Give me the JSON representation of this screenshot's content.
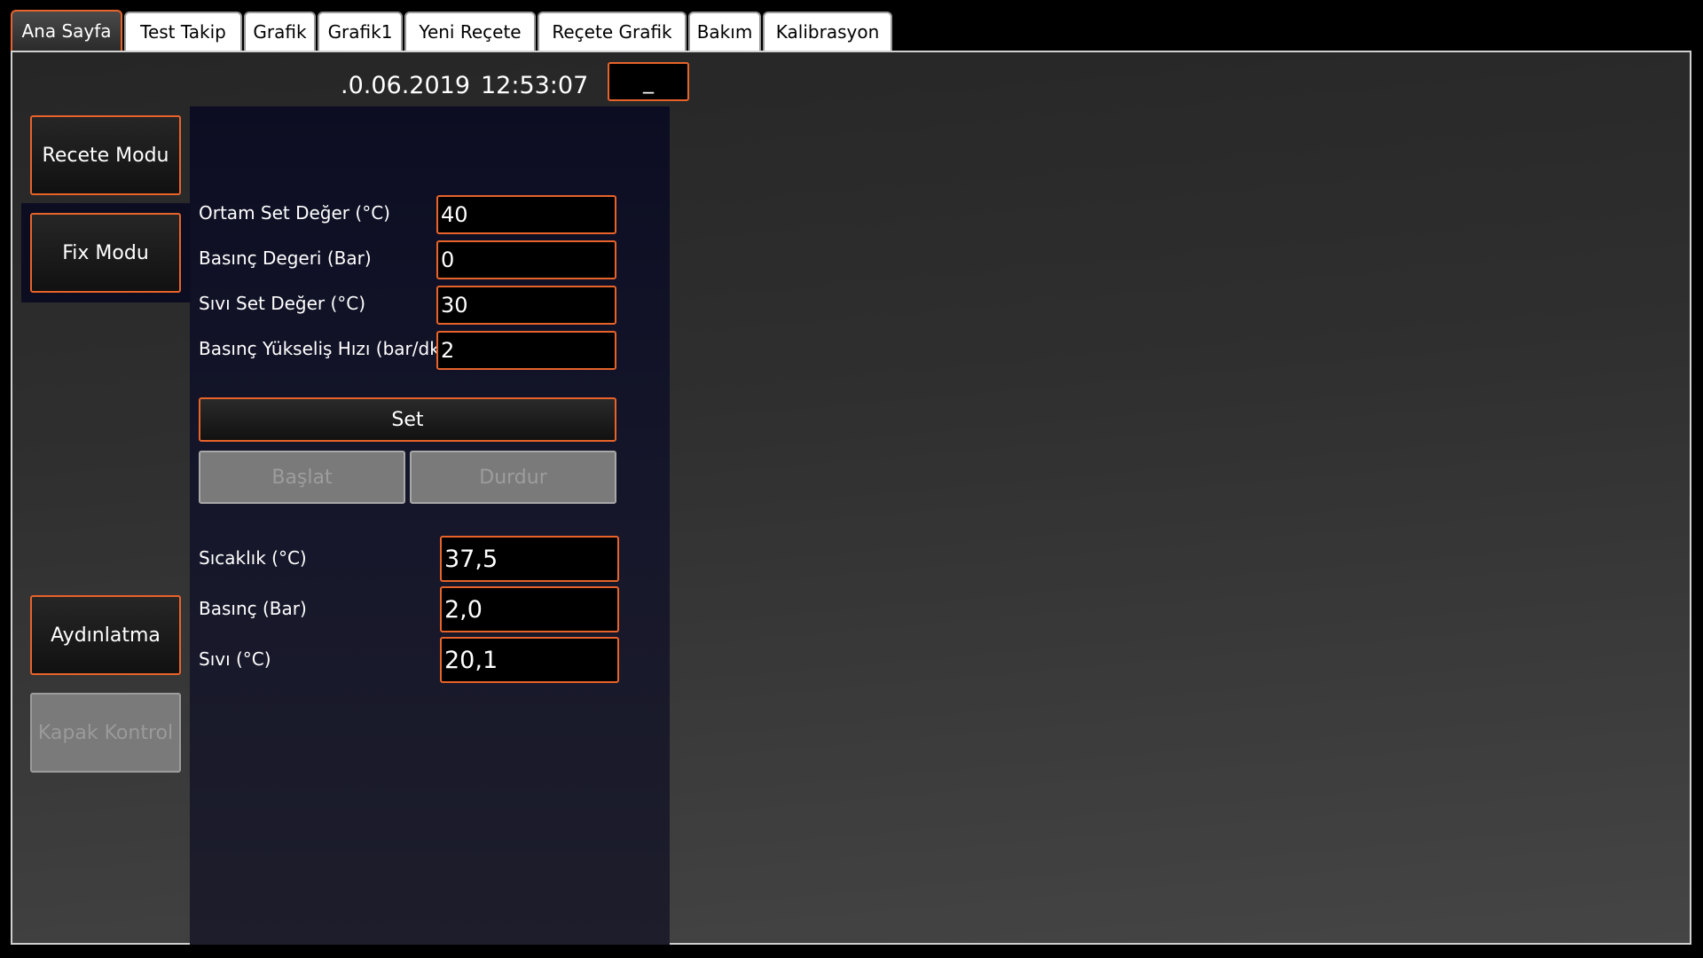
{
  "tabs": [
    {
      "label": "Ana Sayfa",
      "active": true
    },
    {
      "label": "Test Takip"
    },
    {
      "label": "Grafik"
    },
    {
      "label": "Grafik1"
    },
    {
      "label": "Yeni Reçete"
    },
    {
      "label": "Reçete Grafik"
    },
    {
      "label": "Bakım"
    },
    {
      "label": "Kalibrasyon"
    }
  ],
  "header": {
    "date": ".0.06.2019",
    "time": "12:53:07",
    "minimize_label": "_"
  },
  "sidebar": {
    "recete_modu": "Recete Modu",
    "fix_modu": "Fix Modu",
    "aydinlatma": "Aydınlatma",
    "kapak_kontrol": "Kapak Kontrol"
  },
  "settings": {
    "ortam_label": "Ortam Set Değer (°C)",
    "ortam_value": "40",
    "basinc_label": "Basınç Degeri (Bar)",
    "basinc_value": "0",
    "sivi_label": "Sıvı Set Değer (°C)",
    "sivi_value": "30",
    "hiz_label": "Basınç Yükseliş Hızı (bar/dk)",
    "hiz_value": "2"
  },
  "actions": {
    "set_label": "Set",
    "baslat_label": "Başlat",
    "durdur_label": "Durdur"
  },
  "readings": {
    "sicaklik_label": "Sıcaklık (°C)",
    "sicaklik_value": "37,5",
    "basinc_label": "Basınç (Bar)",
    "basinc_value": "2,0",
    "sivi_label": "Sıvı (°C)",
    "sivi_value": "20,1"
  },
  "colors": {
    "accent": "#e8632a",
    "panel": "#12132a",
    "background": "#2f2f2f"
  }
}
